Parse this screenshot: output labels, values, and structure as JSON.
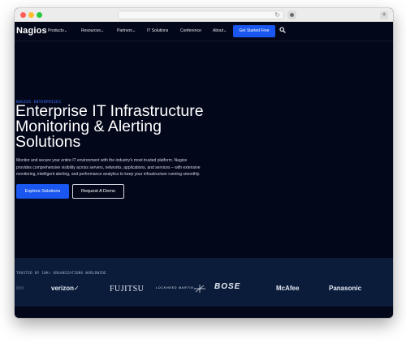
{
  "nav": {
    "logo": "Nagios",
    "items": [
      "Products",
      "Resources",
      "Partners",
      "IT Solutions",
      "Conference",
      "About"
    ],
    "dropdown_marks": [
      "⌄",
      "⌄",
      "⌄",
      "",
      "",
      "⌄"
    ],
    "cta": "Get Started Free"
  },
  "hero": {
    "eyebrow": "NAGIOS ENTERPRISES",
    "title": "Enterprise IT Infrastructure Monitoring & Alerting Solutions",
    "description": "Monitor and secure your entire IT environment with the industry's most trusted platform. Nagios provides comprehensive visibility across servers, networks, applications, and services – with extensive monitoring, intelligent alerting, and performance analytics to keep your infrastructure running smoothly.",
    "primary_button": "Explore Solutions",
    "secondary_button": "Request A Demo"
  },
  "trusted": {
    "label": "TRUSTED BY 10K+ ORGANIZATIONS WORLDWIDE",
    "logos": {
      "partial": "ibm",
      "verizon": "verizon✓",
      "fujitsu": "FUJITSU",
      "lockheed": "LOCKHEED MARTIN",
      "bose": "BOSE",
      "mcafee": "McAfee",
      "panasonic": "Panasonic"
    }
  },
  "browser": {
    "reload_icon": "↻"
  },
  "colors": {
    "background": "#03071a",
    "accent": "#1a56f0",
    "eyebrow": "#3d73ff",
    "trusted_band": "#0b1c3a"
  },
  "icons": [
    "search-icon",
    "chevron-down-icon",
    "reload-icon",
    "extension-icon",
    "new-tab-icon"
  ]
}
